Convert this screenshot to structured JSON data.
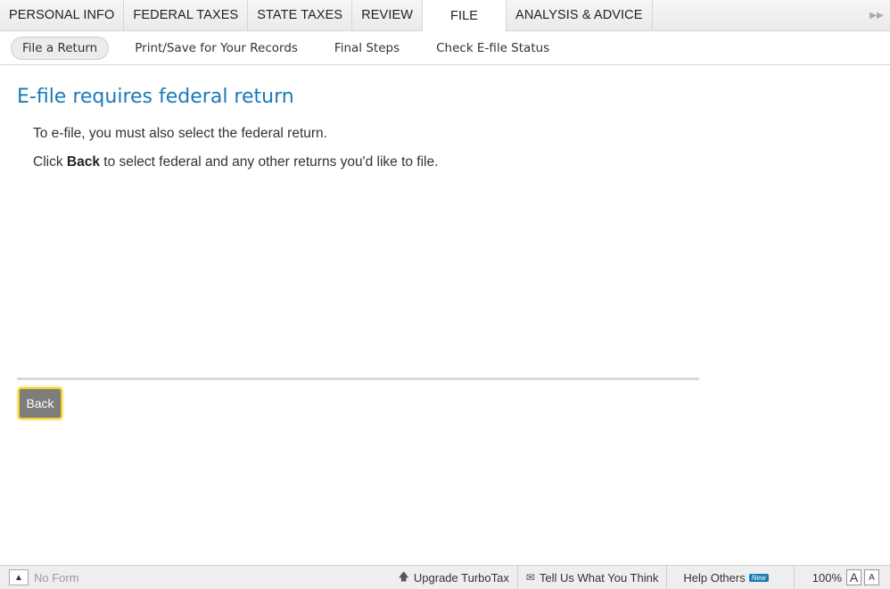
{
  "top_tabs": [
    {
      "label": "PERSONAL INFO"
    },
    {
      "label": "FEDERAL TAXES"
    },
    {
      "label": "STATE TAXES"
    },
    {
      "label": "REVIEW"
    },
    {
      "label": "FILE",
      "active": true
    },
    {
      "label": "ANALYSIS & ADVICE"
    }
  ],
  "collapse_glyph": "▶▶",
  "sub_tabs": [
    {
      "label": "File a Return",
      "active": true
    },
    {
      "label": "Print/Save for Your Records"
    },
    {
      "label": "Final Steps"
    },
    {
      "label": "Check E-file Status"
    }
  ],
  "main": {
    "title": "E-file requires federal return",
    "para1": "To e-file, you must also select the federal return.",
    "para2_pre": "Click ",
    "para2_bold": "Back",
    "para2_post": " to select federal and any other returns you'd like to file.",
    "back_label": "Back"
  },
  "footer": {
    "up_glyph": "▲",
    "no_form": "No Form",
    "upgrade_glyph": "🡅",
    "upgrade": "Upgrade TurboTax",
    "feedback_glyph": "✉",
    "feedback": "Tell Us What You Think",
    "help": "Help Others",
    "new_badge": "New",
    "zoom": "100%",
    "font_large": "A",
    "font_small": "A"
  },
  "colors": {
    "title": "#1a7ab8",
    "button": "#7d7d7d",
    "focus": "#f2d230"
  }
}
